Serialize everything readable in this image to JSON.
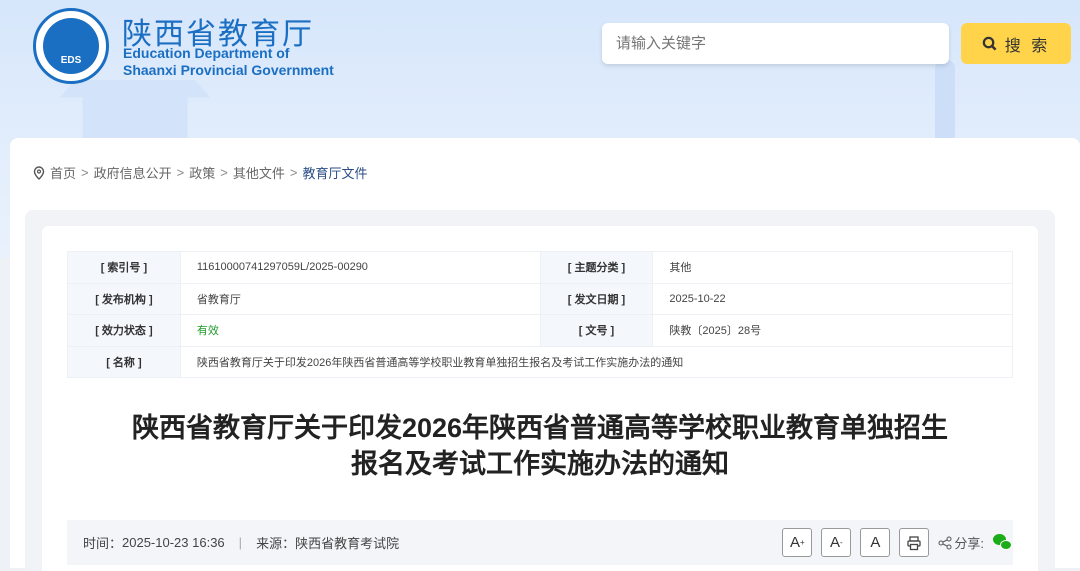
{
  "header": {
    "logo_text": "EDS",
    "title_cn": "陕西省教育厅",
    "title_en_1": "Education Department of",
    "title_en_2": "Shaanxi Provincial Government",
    "search_placeholder": "请输入关键字",
    "search_button": "搜 索"
  },
  "breadcrumb": [
    "首页",
    "政府信息公开",
    "政策",
    "其他文件",
    "教育厅文件"
  ],
  "info": {
    "index_label": "[ 索引号 ]",
    "index_value": "11610000741297059L/2025-00290",
    "topic_label": "[ 主题分类 ]",
    "topic_value": "其他",
    "org_label": "[ 发布机构 ]",
    "org_value": "省教育厅",
    "date_label": "[ 发文日期 ]",
    "date_value": "2025-10-22",
    "status_label": "[ 效力状态 ]",
    "status_value": "有效",
    "docno_label": "[ 文号 ]",
    "docno_value": "陕教〔2025〕28号",
    "name_label": "[ 名称 ]",
    "name_value": "陕西省教育厅关于印发2026年陕西省普通高等学校职业教育单独招生报名及考试工作实施办法的通知"
  },
  "article": {
    "title_line1": "陕西省教育厅关于印发2026年陕西省普通高等学校职业教育单独招生",
    "title_line2": "报名及考试工作实施办法的通知",
    "time_label": "时间：",
    "time": "2025-10-23 16:36",
    "sep": "|",
    "source_label": "来源：",
    "source": "陕西省教育考试院",
    "font_larger": "A",
    "font_smaller": "A",
    "font_default": "A",
    "share_label": "分享:"
  },
  "colors": {
    "brand": "#1b6fc2",
    "search_btn": "#ffd44a",
    "valid": "#1d9a2a",
    "wechat": "#1aad19"
  }
}
